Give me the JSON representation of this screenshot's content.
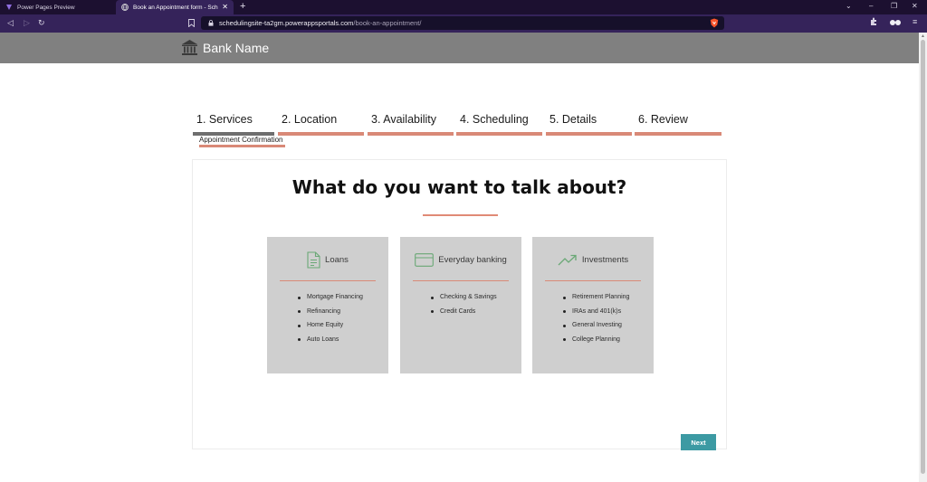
{
  "browser": {
    "tabs": [
      {
        "label": "Power Pages Preview"
      },
      {
        "label": "Book an Appointment form - Sch"
      }
    ],
    "url_host": "schedulingsite-ta2gm.powerappsportals.com",
    "url_path": "/book-an-appointment/"
  },
  "header": {
    "bank_name": "Bank Name"
  },
  "steps": [
    {
      "label": "1. Services",
      "active": true
    },
    {
      "label": "2. Location"
    },
    {
      "label": "3. Availability"
    },
    {
      "label": "4. Scheduling"
    },
    {
      "label": "5. Details"
    },
    {
      "label": "6. Review"
    },
    {
      "label": "Appointment Confirmation"
    }
  ],
  "main": {
    "title": "What do you want to talk about?",
    "cards": [
      {
        "title": "Loans",
        "icon": "document-icon",
        "items": [
          "Mortgage Financing",
          "Refinancing",
          "Home Equity",
          "Auto Loans"
        ]
      },
      {
        "title": "Everyday banking",
        "icon": "credit-card-icon",
        "items": [
          "Checking & Savings",
          "Credit Cards"
        ]
      },
      {
        "title": "Investments",
        "icon": "trend-up-icon",
        "items": [
          "Retirement Planning",
          "IRAs and 401(k)s",
          "General Investing",
          "College Planning"
        ]
      }
    ],
    "next_label": "Next"
  },
  "colors": {
    "accent": "#d98977",
    "active_step": "#6e6e6e",
    "header_bg": "#808080",
    "card_bg": "#cfcfcf",
    "icon_green": "#6aa876",
    "button_teal": "#3c9aa3"
  }
}
